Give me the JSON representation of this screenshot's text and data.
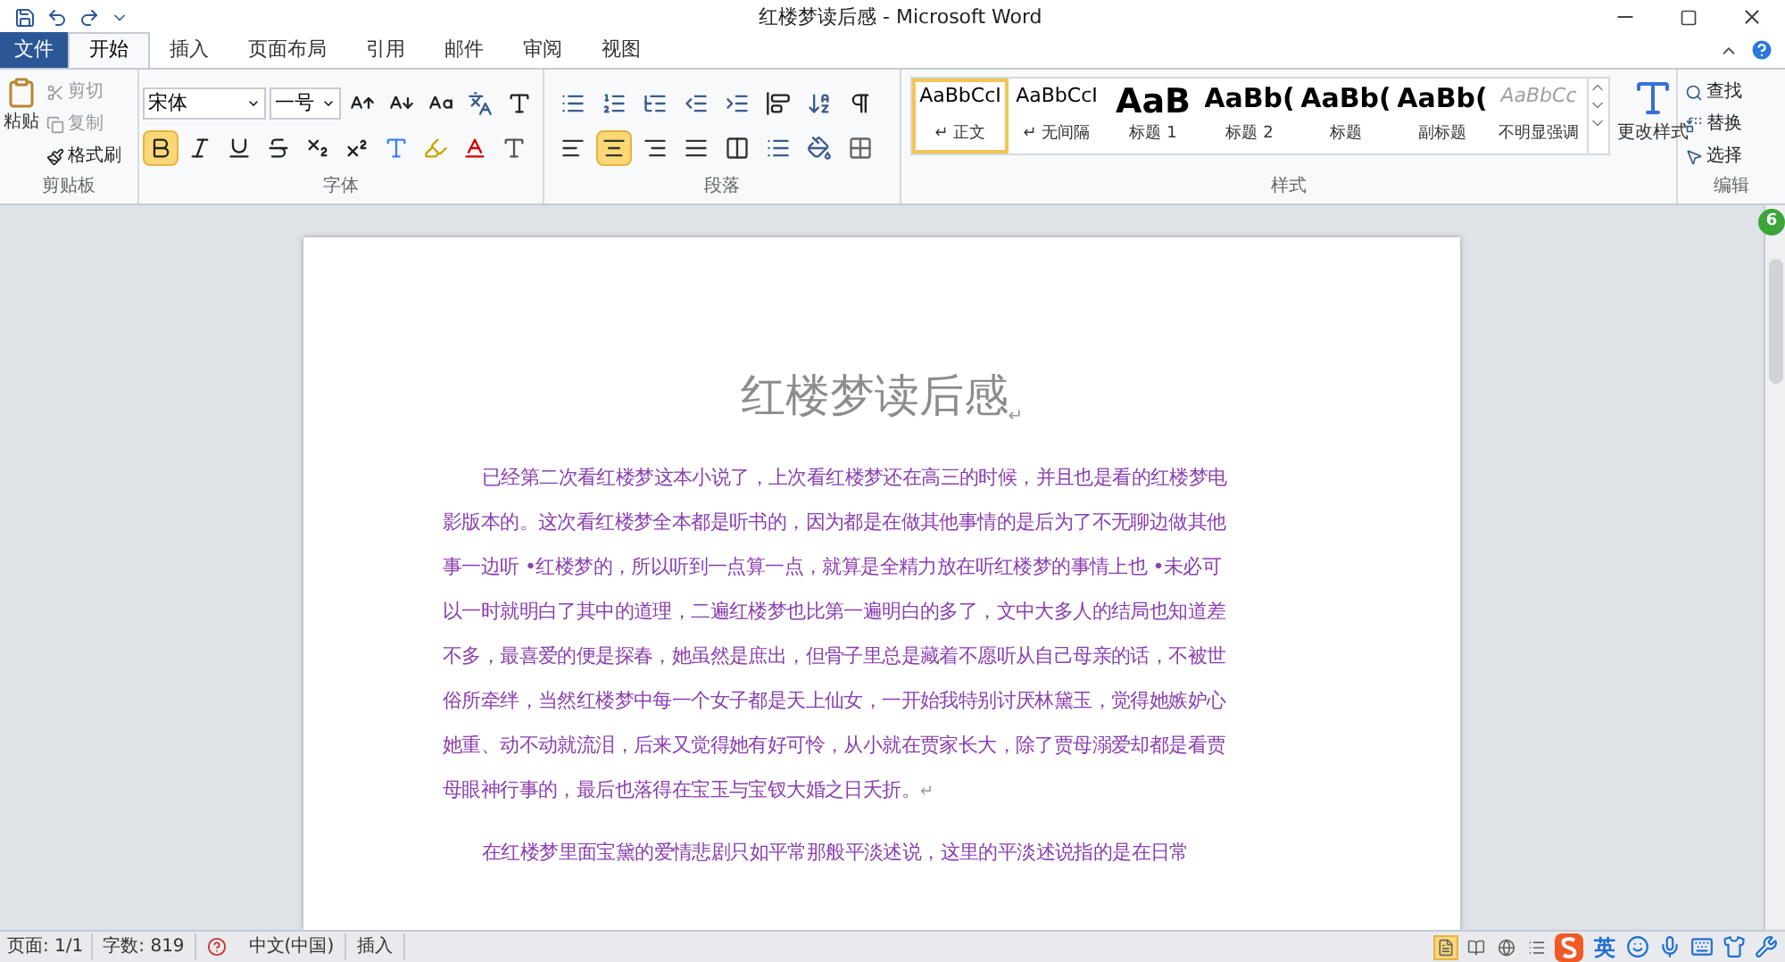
{
  "window": {
    "title": "红楼梦读后感 - Microsoft Word"
  },
  "tabs": [
    {
      "label": "文件",
      "kind": "file",
      "selected": false
    },
    {
      "label": "开始",
      "kind": "tab",
      "selected": true
    },
    {
      "label": "插入",
      "kind": "tab",
      "selected": false
    },
    {
      "label": "页面布局",
      "kind": "tab",
      "selected": false
    },
    {
      "label": "引用",
      "kind": "tab",
      "selected": false
    },
    {
      "label": "邮件",
      "kind": "tab",
      "selected": false
    },
    {
      "label": "审阅",
      "kind": "tab",
      "selected": false
    },
    {
      "label": "视图",
      "kind": "tab",
      "selected": false
    }
  ],
  "clipboard": {
    "label": "剪贴板",
    "paste": "粘贴",
    "items": [
      {
        "label": "剪切",
        "disabled": true
      },
      {
        "label": "复制",
        "disabled": true
      },
      {
        "label": "格式刷",
        "disabled": false
      }
    ]
  },
  "font": {
    "label": "字体",
    "font_name": "宋体",
    "font_size": "一号",
    "bold": true
  },
  "paragraph": {
    "label": "段落",
    "alignments": [
      {
        "kind": "left",
        "selected": false
      },
      {
        "kind": "center",
        "selected": true
      },
      {
        "kind": "right",
        "selected": false
      },
      {
        "kind": "justify",
        "selected": false
      },
      {
        "kind": "distributed",
        "selected": false
      }
    ]
  },
  "styles": {
    "label": "样式",
    "change": "更改样式",
    "items": [
      {
        "preview": "AaBbCcI",
        "label": "↵ 正文",
        "kind": "normal",
        "selected": true
      },
      {
        "preview": "AaBbCcI",
        "label": "↵ 无间隔",
        "kind": "normal",
        "selected": false
      },
      {
        "preview": "AaB",
        "label": "标题 1",
        "kind": "heading1",
        "selected": false
      },
      {
        "preview": "AaBb(",
        "label": "标题 2",
        "kind": "heading",
        "selected": false
      },
      {
        "preview": "AaBb(",
        "label": "标题",
        "kind": "heading",
        "selected": false
      },
      {
        "preview": "AaBb(",
        "label": "副标题",
        "kind": "heading",
        "selected": false
      },
      {
        "preview": "AaBbCc",
        "label": "不明显强调",
        "kind": "subtle",
        "selected": false
      }
    ]
  },
  "editing": {
    "label": "编辑",
    "items": [
      {
        "label": "查找",
        "kind": "find"
      },
      {
        "label": "替换",
        "kind": "replace"
      },
      {
        "label": "选择",
        "kind": "select"
      }
    ]
  },
  "badge": "6",
  "document": {
    "title": "红楼梦读后感",
    "title_mark": "↵",
    "paragraphs": [
      {
        "text": "已经第二次看红楼梦这本小说了，上次看红楼梦还在高三的时候，并且也是看的红楼梦电影版本的。这次看红楼梦全本都是听书的，因为都是在做其他事情的是后为了不无聊边做其他事一边听 •红楼梦的，所以听到一点算一点，就算是全精力放在听红楼梦的事情上也 •未必可以一时就明白了其中的道理，二遍红楼梦也比第一遍明白的多了，文中大多人的结局也知道差不多，最喜爱的便是探春，她虽然是庶出，但骨子里总是藏着不愿听从自己母亲的话，不被世俗所牵绊，当然红楼梦中每一个女子都是天上仙女，一开始我特别讨厌林黛玉，觉得她嫉妒心她重、动不动就流泪，后来又觉得她有好可怜，从小就在贾家长大，除了贾母溺爱却都是看贾母眼神行事的，最后也落得在宝玉与宝钗大婚之日夭折。",
        "mark": "↵"
      },
      {
        "text": "在红楼梦里面宝黛的爱情悲剧只如平常那般平淡述说，这里的平淡述说指的是在日常"
      }
    ]
  },
  "status_bar": {
    "page": "页面: 1/1",
    "words": "字数: 819",
    "language": "中文(中国)",
    "mode": "插入",
    "views": [
      {
        "kind": "print",
        "selected": true
      },
      {
        "kind": "reading",
        "selected": false
      },
      {
        "kind": "web",
        "selected": false
      },
      {
        "kind": "outline",
        "selected": false
      }
    ],
    "ime": "英"
  }
}
